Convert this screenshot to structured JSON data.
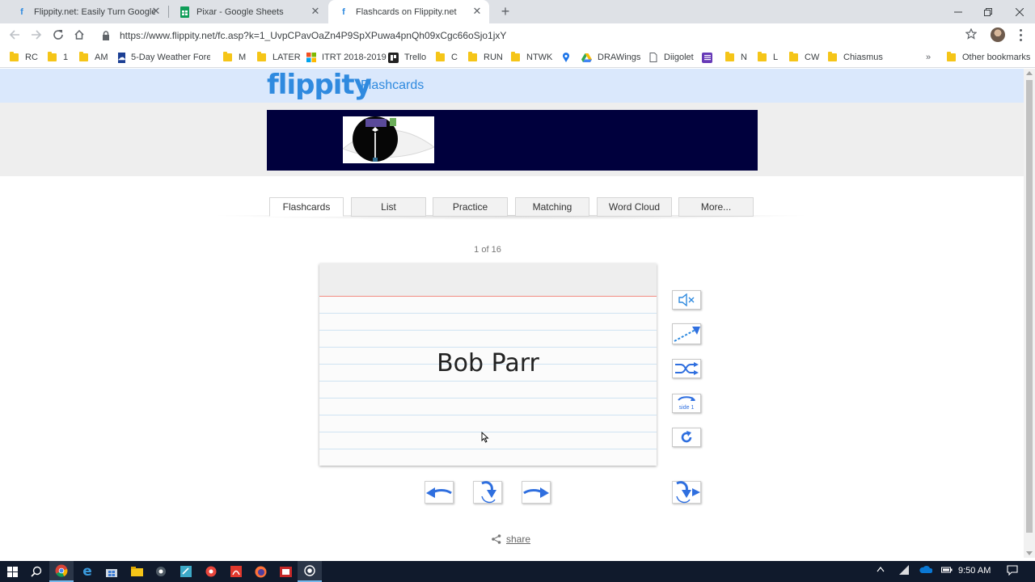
{
  "browser": {
    "tabs": [
      {
        "title": "Flippity.net: Easily Turn Google S",
        "icon": "flippity-f-icon",
        "active": false
      },
      {
        "title": "Pixar - Google Sheets",
        "icon": "google-sheets-icon",
        "active": false
      },
      {
        "title": "Flashcards on Flippity.net",
        "icon": "flippity-f-icon",
        "active": true
      }
    ],
    "url": "https://www.flippity.net/fc.asp?k=1_UvpCPavOaZn4P9SpXPuwa4pnQh09xCgc66oSjo1jxY",
    "bookmarks": [
      {
        "label": "RC",
        "icon": "folder-icon"
      },
      {
        "label": "1",
        "icon": "folder-icon"
      },
      {
        "label": "AM",
        "icon": "folder-icon"
      },
      {
        "label": "5-Day Weather Forec",
        "icon": "weather-icon"
      },
      {
        "label": "M",
        "icon": "folder-icon"
      },
      {
        "label": "LATER",
        "icon": "folder-icon"
      },
      {
        "label": "ITRT 2018-2019",
        "icon": "microsoft-icon"
      },
      {
        "label": "Trello",
        "icon": "trello-icon"
      },
      {
        "label": "C",
        "icon": "folder-icon"
      },
      {
        "label": "RUN",
        "icon": "folder-icon"
      },
      {
        "label": "NTWK",
        "icon": "folder-icon"
      },
      {
        "label": "",
        "icon": "map-pin-icon"
      },
      {
        "label": "DRAWings",
        "icon": "google-drive-icon"
      },
      {
        "label": "Diigolet",
        "icon": "page-icon"
      },
      {
        "label": "",
        "icon": "forms-icon"
      },
      {
        "label": "N",
        "icon": "folder-icon"
      },
      {
        "label": "L",
        "icon": "folder-icon"
      },
      {
        "label": "CW",
        "icon": "folder-icon"
      },
      {
        "label": "Chiasmus",
        "icon": "folder-icon"
      }
    ],
    "overflow": "»",
    "other_bookmarks": "Other bookmarks"
  },
  "site": {
    "logo": "flippity",
    "section": "Flashcards"
  },
  "nav_tabs": [
    "Flashcards",
    "List",
    "Practice",
    "Matching",
    "Word Cloud",
    "More..."
  ],
  "active_tab": "Flashcards",
  "flashcard": {
    "counter": "1 of 16",
    "text": "Bob Parr"
  },
  "controls": {
    "side_buttons": [
      "mute-icon",
      "auto-play-icon",
      "shuffle-icon",
      "side-1-icon",
      "refresh-icon"
    ],
    "side1_label": "side 1",
    "nav_buttons": [
      "previous-icon",
      "flip-icon",
      "next-icon"
    ],
    "flip_next_button": "flip-next-icon",
    "share_label": "share"
  },
  "accent_color": "#2f8adf",
  "taskbar": {
    "time": "9:50 AM"
  }
}
